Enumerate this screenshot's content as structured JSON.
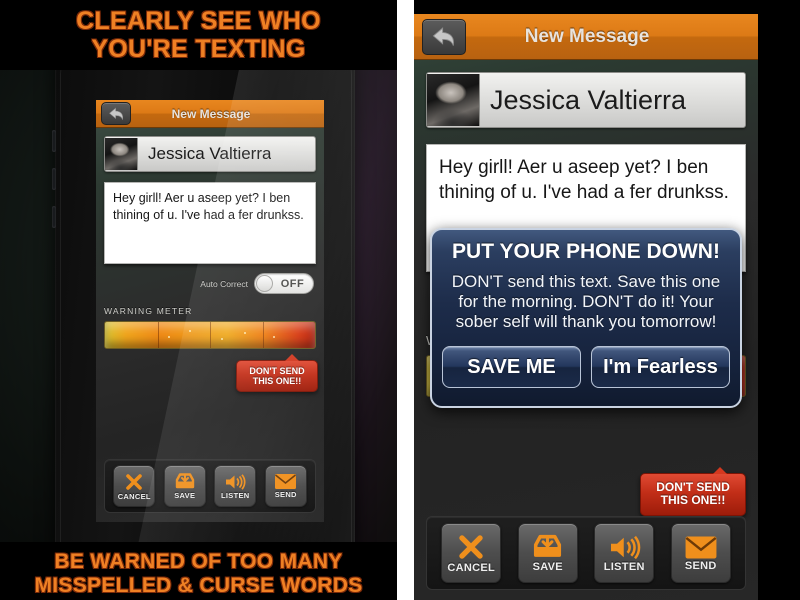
{
  "left_panel": {
    "caption_top_line1": "CLEARLY SEE WHO",
    "caption_top_line2": "YOU'RE TEXTING",
    "caption_bottom_line1": "BE WARNED OF TOO MANY",
    "caption_bottom_line2": "MISSPELLED & CURSE WORDS"
  },
  "app": {
    "navbar": {
      "title": "New Message",
      "back_icon": "back-arrow-icon"
    },
    "recipient": {
      "name": "Jessica Valtierra",
      "avatar_icon": "contact-photo"
    },
    "message": {
      "text": "Hey girll! Aer u aseep yet? I ben thining of u. I've had a fer drunkss."
    },
    "auto_correct": {
      "label": "Auto Correct",
      "state": "OFF"
    },
    "warning_meter": {
      "label": "WARNING METER",
      "tooltip_line1": "DON'T SEND",
      "tooltip_line2": "THIS ONE!!"
    },
    "toolbar": [
      {
        "label": "CANCEL",
        "icon": "close-x-icon"
      },
      {
        "label": "SAVE",
        "icon": "save-inbox-icon"
      },
      {
        "label": "LISTEN",
        "icon": "speaker-icon"
      },
      {
        "label": "SEND",
        "icon": "envelope-icon"
      }
    ]
  },
  "modal": {
    "title": "PUT YOUR PHONE DOWN!",
    "body_line1": "DON'T send this text. Save this one",
    "body_line2": "for the morning. DON'T do it! Your",
    "body_line3": "sober self will thank you tomorrow!",
    "primary_button": "SAVE ME",
    "secondary_button": "I'm Fearless"
  },
  "colors": {
    "accent_orange": "#e8871f",
    "caption_orange": "#ef8024",
    "warning_red": "#c22e18",
    "modal_blue": "#1d2c4a"
  }
}
